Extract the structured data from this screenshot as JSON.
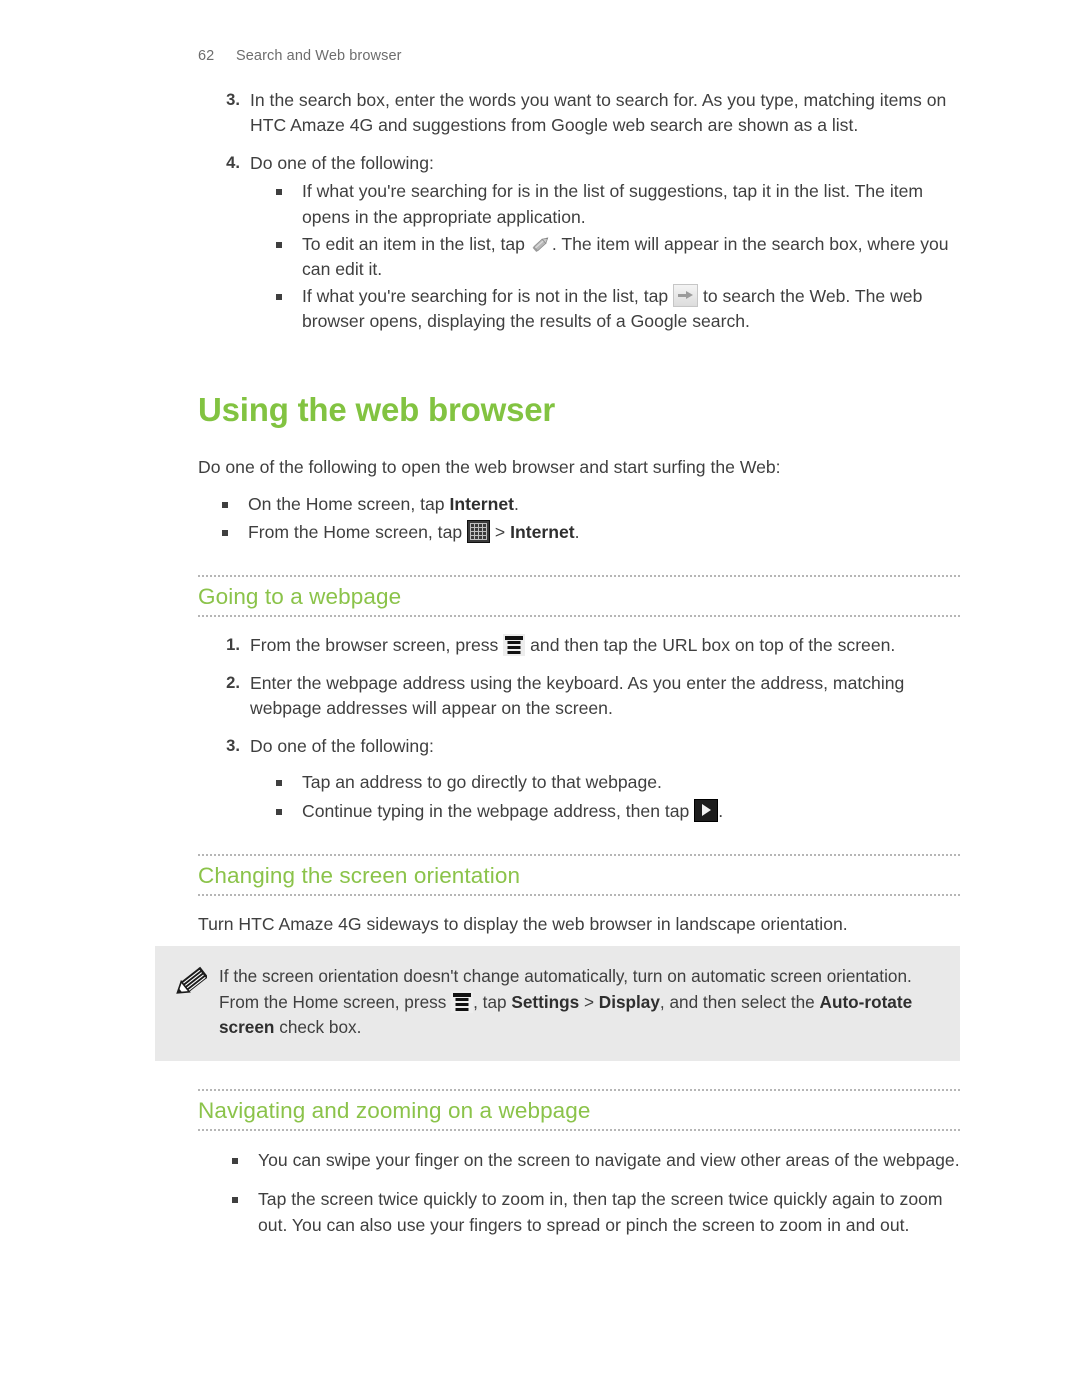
{
  "page": {
    "number": "62",
    "running_header": "Search and Web browser"
  },
  "colors": {
    "heading_green": "#82c341",
    "subheading_green": "#8bc34a",
    "body_text": "#3f3f3f",
    "note_background": "#e9e9e9",
    "rule_dotted": "#b6b6b6"
  },
  "top_steps": {
    "step3": {
      "number": "3.",
      "text": "In the search box, enter the words you want to search for. As you type, matching items on HTC Amaze 4G and suggestions from Google web search are shown as a list."
    },
    "step4": {
      "number": "4.",
      "text": "Do one of the following:"
    },
    "bullets": {
      "b1": "If what you're searching for is in the list of suggestions, tap it in the list. The item opens in the appropriate application.",
      "b2_before": "To edit an item in the list, tap",
      "b2_icon": "pencil-edit-icon",
      "b2_after": ". The item will appear in the search box, where you can edit it.",
      "b3_before": "If what you're searching for is not in the list, tap",
      "b3_icon": "arrow-right-button-icon",
      "b3_after": "to search the Web. The web browser opens, displaying the results of a Google search."
    }
  },
  "main_heading": "Using the web browser",
  "intro": "Do one of the following to open the web browser and start surfing the Web:",
  "intro_bullets": {
    "b1_before": "On the Home screen, tap",
    "b1_bold": "Internet",
    "b1_after": ".",
    "b2_before": "From the Home screen, tap",
    "b2_icon": "app-drawer-grid-icon",
    "b2_mid": ">",
    "b2_bold": "Internet",
    "b2_after": "."
  },
  "section_going": {
    "heading": "Going to a webpage",
    "step1": {
      "number": "1.",
      "before": "From the browser screen, press",
      "icon": "menu-bars-icon",
      "after": "and then tap the URL box on top of the screen."
    },
    "step2": {
      "number": "2.",
      "text": "Enter the webpage address using the keyboard. As you enter the address, matching webpage addresses will appear on the screen."
    },
    "step3": {
      "number": "3.",
      "text": "Do one of the following:"
    },
    "bullets": {
      "b1": "Tap an address to go directly to that webpage.",
      "b2_before": "Continue typing in the webpage address, then tap",
      "b2_icon": "go-play-button-icon",
      "b2_after": "."
    }
  },
  "section_orientation": {
    "heading": "Changing the screen orientation",
    "paragraph": "Turn HTC Amaze 4G sideways to display the web browser in landscape orientation."
  },
  "note": {
    "icon": "pencil-note-icon",
    "line1": "If the screen orientation doesn't change automatically, turn on automatic screen",
    "line2_before": "orientation. From the Home screen, press",
    "line2_icon": "menu-bars-icon",
    "line2_mid": ", tap",
    "line2_bold1": "Settings",
    "line2_gt": ">",
    "line2_bold2": "Display",
    "line2_after": ", and then",
    "line3_before": "select the",
    "line3_bold": "Auto-rotate screen",
    "line3_after": "check box."
  },
  "section_navigating": {
    "heading": "Navigating and zooming on a webpage",
    "bullets": {
      "b1": "You can swipe your finger on the screen to navigate and view other areas of the webpage.",
      "b2": "Tap the screen twice quickly to zoom in, then tap the screen twice quickly again to zoom out. You can also use your fingers to spread or pinch the screen to zoom in and out."
    }
  }
}
